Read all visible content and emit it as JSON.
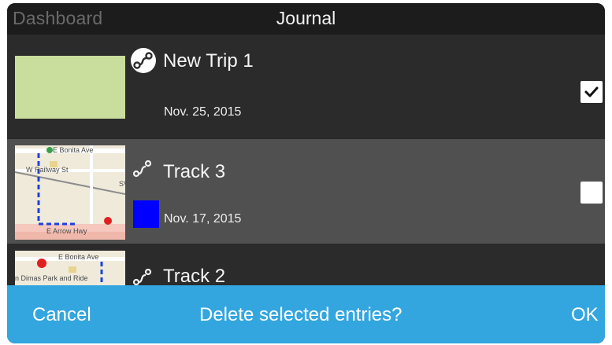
{
  "header": {
    "back_label": "Dashboard",
    "title": "Journal"
  },
  "entries": [
    {
      "name": "New Trip 1",
      "date": "Nov. 25, 2015",
      "checked": true,
      "thumbnail": "blank-green",
      "icon": "route-icon-circled"
    },
    {
      "name": "Track 3",
      "date": "Nov. 17, 2015",
      "checked": false,
      "color": "#0000ff",
      "thumbnail": "map",
      "map_labels": [
        "E Bonita Ave",
        "W Railway St",
        "SV",
        "E Arrow Hwy"
      ],
      "icon": "route-icon"
    },
    {
      "name": "Track 2",
      "thumbnail": "map",
      "map_labels": [
        "E Bonita Ave",
        "n Dimas Park and Ride"
      ],
      "icon": "route-icon"
    }
  ],
  "action_bar": {
    "cancel_label": "Cancel",
    "prompt": "Delete selected entries?",
    "ok_label": "OK"
  },
  "colors": {
    "header_bg": "#1c1c1c",
    "row_bg": "#2b2b2b",
    "selected_row_bg": "#505050",
    "action_bar_bg": "#34a6df",
    "thumb_blank": "#c9dd9c"
  }
}
